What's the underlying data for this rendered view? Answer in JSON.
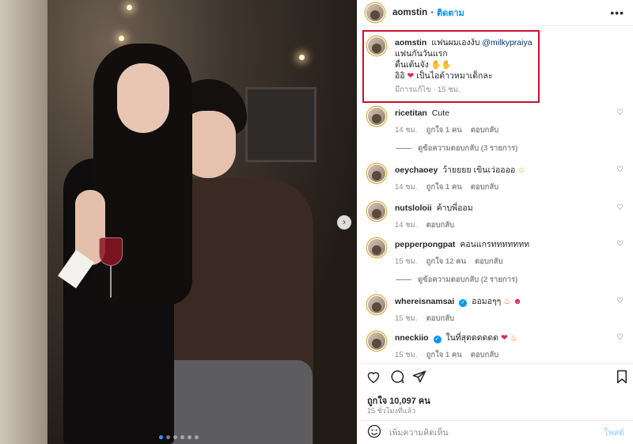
{
  "post": {
    "carousel": {
      "slide_count": 6,
      "active_index": 0
    }
  },
  "header": {
    "username": "aomstin",
    "separator": "•",
    "follow_label": "ติดตาม",
    "more_label": "•••"
  },
  "caption": {
    "username": "aomstin",
    "text": "แฟนผมเองงับ",
    "mention": "@milkypraiya",
    "line2": "แฟนกันวันแรก",
    "line3": "ตื่นเต้นจัง",
    "line4_a": "อิอิ",
    "line4_b": "เป็นไอต้าวหมาเด็กละ",
    "edited": "มีการแก้ไข · 15 ชม."
  },
  "comments": [
    {
      "username": "ricetitan",
      "text": "Cute",
      "time": "14 ชม.",
      "likes": "ถูกใจ 1 คน",
      "reply": "ตอบกลับ",
      "replies": "ดูข้อความตอบกลับ (3 รายการ)"
    },
    {
      "username": "oeychaoey",
      "text": "ว้ายยยย เขินเว่ออออ",
      "time": "14 ชม.",
      "likes": "ถูกใจ 1 คน",
      "reply": "ตอบกลับ"
    },
    {
      "username": "nutsloloii",
      "text": "ค้าบพี่ออม",
      "time": "14 ชม.",
      "reply": "ตอบกลับ"
    },
    {
      "username": "pepperpongpat",
      "text": "คอนแกรททททททท",
      "time": "15 ชม.",
      "likes": "ถูกใจ 12 คน",
      "reply": "ตอบกลับ",
      "replies": "ดูข้อความตอบกลับ (2 รายการ)"
    },
    {
      "username": "whereisnamsai",
      "text": "ออมอๆๆ",
      "time": "15 ชม.",
      "reply": "ตอบกลับ",
      "verified": true
    },
    {
      "username": "nneckiio",
      "text": "ในที่สุดดดดดด",
      "time": "15 ชม.",
      "likes": "ถูกใจ 1 คน",
      "reply": "ตอบกลับ",
      "verified": true
    }
  ],
  "actions": {
    "like_count": "ถูกใจ 10,097 คน",
    "timestamp": "15 ชั่วโมงที่แล้ว"
  },
  "add_comment": {
    "placeholder": "เพิ่มความคิดเห็น",
    "post_label": "โพสต์"
  },
  "colors": {
    "accent": "#0095f6",
    "highlight_box": "#c8102e"
  }
}
